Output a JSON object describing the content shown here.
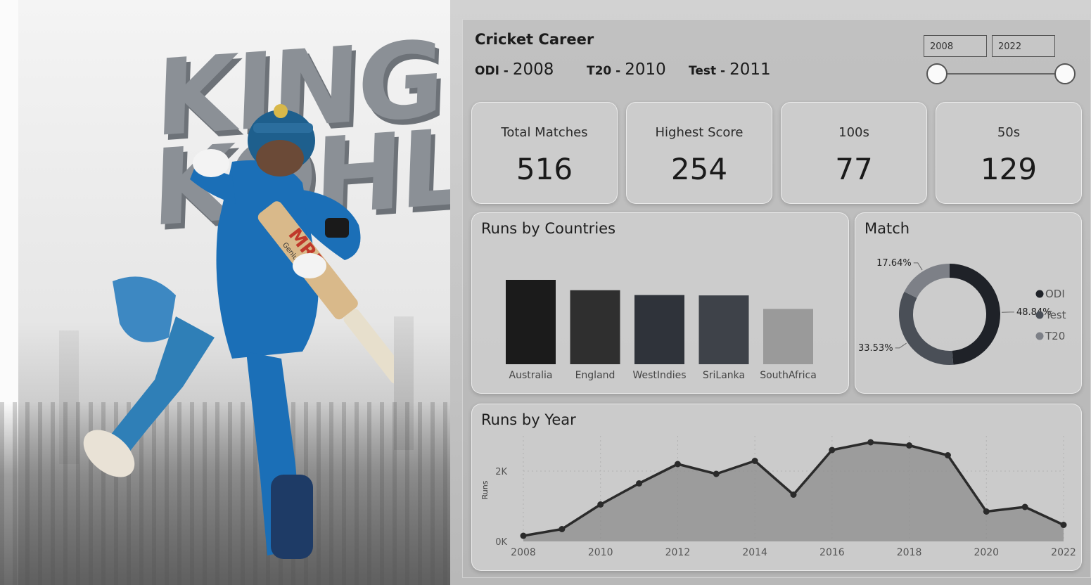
{
  "hero": {
    "title_line1": "KING",
    "title_line2": "KOHLI",
    "bat_brand": "MRF",
    "bat_text": "Genius"
  },
  "career": {
    "title": "Cricket Career",
    "formats": [
      {
        "label": "ODI -",
        "year": "2008"
      },
      {
        "label": "T20 -",
        "year": "2010"
      },
      {
        "label": "Test -",
        "year": "2011"
      }
    ]
  },
  "year_range": {
    "from": "2008",
    "to": "2022",
    "min": 2008,
    "max": 2022,
    "value_from": 2008,
    "value_to": 2022
  },
  "kpis": [
    {
      "label": "Total Matches",
      "value": "516"
    },
    {
      "label": "Highest Score",
      "value": "254"
    },
    {
      "label": "100s",
      "value": "77"
    },
    {
      "label": "50s",
      "value": "129"
    }
  ],
  "colors": {
    "dark": "#1e1e1e",
    "line": "#2b2b2b",
    "area": "#8c8c8c"
  },
  "chart_data": [
    {
      "type": "bar",
      "title": "Runs by Countries",
      "categories": [
        "Australia",
        "England",
        "WestIndies",
        "SriLanka",
        "SouthAfrica"
      ],
      "values": [
        2440,
        2140,
        2000,
        1990,
        1600
      ],
      "colors": [
        "#1b1b1b",
        "#2f2f2f",
        "#2f333a",
        "#3e4249",
        "#9a9a9a"
      ]
    },
    {
      "type": "pie",
      "title": "Match",
      "labels": [
        "ODI",
        "Test",
        "T20"
      ],
      "values": [
        48.84,
        33.53,
        17.64
      ],
      "value_labels": [
        "48.84%",
        "33.53%",
        "17.64%"
      ],
      "colors": [
        "#1f2228",
        "#4a4f57",
        "#7d8087"
      ],
      "legend_placement": "right"
    },
    {
      "type": "area",
      "title": "Runs by Year",
      "ylabel": "Runs",
      "x": [
        2008,
        2009,
        2010,
        2011,
        2012,
        2013,
        2014,
        2015,
        2016,
        2017,
        2018,
        2019,
        2020,
        2021,
        2022
      ],
      "values": [
        160,
        350,
        1050,
        1650,
        2200,
        1920,
        2290,
        1330,
        2600,
        2820,
        2730,
        2450,
        850,
        980,
        470
      ],
      "xticks": [
        "2008",
        "2010",
        "2012",
        "2014",
        "2016",
        "2018",
        "2020",
        "2022"
      ],
      "yticks": [
        "0K",
        "2K"
      ],
      "ylim": [
        0,
        3000
      ],
      "grid": true
    }
  ]
}
